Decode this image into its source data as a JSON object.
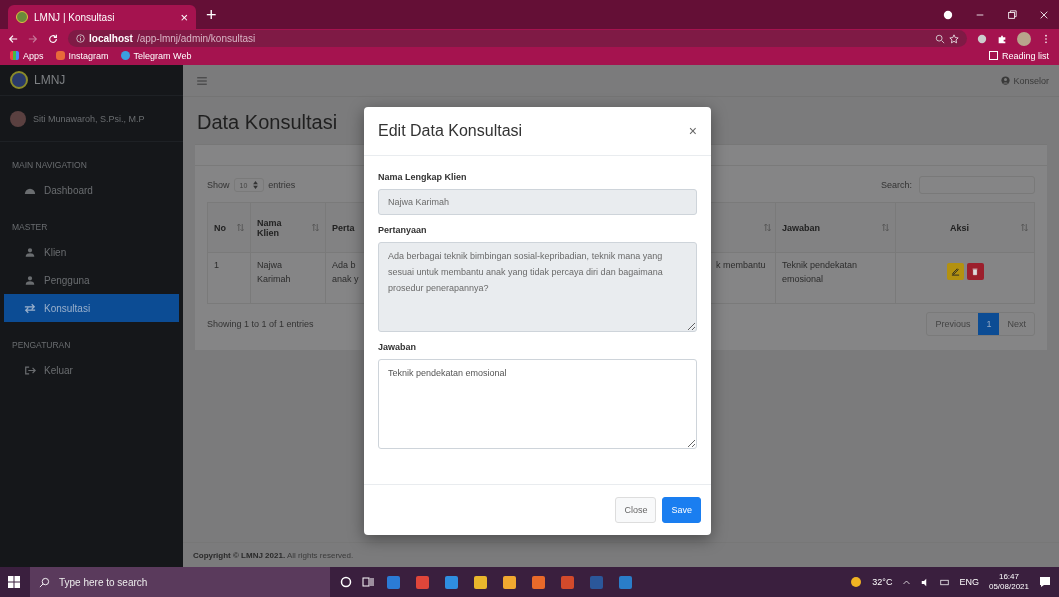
{
  "browser": {
    "tab_title": "LMNJ | Konsultasi",
    "tab_close": "×",
    "new_tab": "+",
    "url_host": "localhost",
    "url_path": "/app-lmnj/admin/konsultasi",
    "bookmarks": [
      "Apps",
      "Instagram",
      "Telegram Web"
    ],
    "reading_list": "Reading list"
  },
  "sidebar": {
    "brand": "LMNJ",
    "user_name": "Siti Munawaroh, S.Psi., M.P",
    "sections": [
      {
        "heading": "MAIN NAVIGATION",
        "items": [
          {
            "label": "Dashboard",
            "kind": "dashboard",
            "selected": false
          }
        ]
      },
      {
        "heading": "MASTER",
        "items": [
          {
            "label": "Klien",
            "kind": "people",
            "selected": false
          },
          {
            "label": "Pengguna",
            "kind": "people",
            "selected": false
          },
          {
            "label": "Konsultasi",
            "kind": "consult",
            "selected": true
          }
        ]
      },
      {
        "heading": "PENGATURAN",
        "items": [
          {
            "label": "Keluar",
            "kind": "exit",
            "selected": false
          }
        ]
      }
    ]
  },
  "topbar": {
    "user_role": "Konselor"
  },
  "page_title": "Data Konsultasi",
  "table": {
    "show_label": "Show",
    "length": "10",
    "entries_label": "entries",
    "search_label": "Search:",
    "columns": [
      "No",
      "Nama Klien",
      "Perta",
      "Jawaban",
      "Aksi"
    ],
    "rows": [
      {
        "no": "1",
        "name": "Najwa Karimah",
        "question_start": "Ada b anak y",
        "question_end": "k membantu",
        "answer": "Teknik pendekatan emosional"
      }
    ],
    "info": "Showing 1 to 1 of 1 entries",
    "pagination": {
      "previous": "Previous",
      "pages": [
        {
          "label": "1",
          "selected": true
        }
      ],
      "next": "Next"
    }
  },
  "footer": "**Copyright © LMNJ 2021.** All rights reserved.",
  "modal": {
    "title": "Edit Data Konsultasi",
    "close": "×",
    "fields": [
      {
        "label": "Nama Lengkap Klien",
        "kind": "input",
        "value": "Najwa Karimah",
        "disabled": true
      },
      {
        "label": "Pertanyaan",
        "kind": "textarea",
        "value": "Ada berbagai teknik bimbingan sosial-kepribadian, teknik mana yang sesuai untuk membantu anak yang tidak percaya diri dan bagaimana prosedur penerapannya?",
        "disabled": true
      },
      {
        "label": "Jawaban",
        "kind": "textarea",
        "value": "Teknik pendekatan emosional",
        "disabled": false
      }
    ],
    "buttons": [
      {
        "label": "Close",
        "kind": "secondary"
      },
      {
        "label": "Save",
        "kind": "primary"
      }
    ]
  },
  "taskbar": {
    "search_placeholder": "Type here to search",
    "weather": "32°C",
    "language": "ENG",
    "time": "16:47",
    "date": "05/08/2021"
  }
}
